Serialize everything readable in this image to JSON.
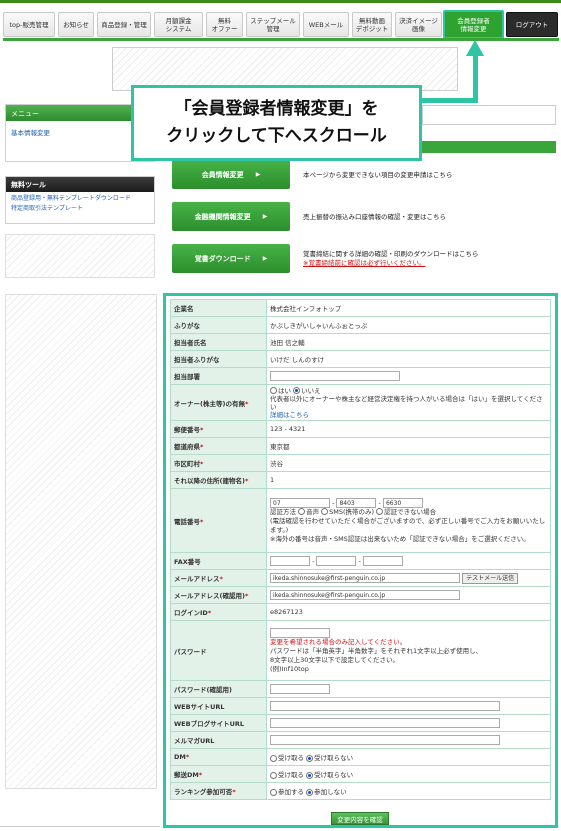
{
  "nav": {
    "items": [
      {
        "label": "top-販売管理"
      },
      {
        "label": "お知らせ"
      },
      {
        "label": "商品登録・管理"
      },
      {
        "label": "月額課金\nシステム"
      },
      {
        "label": "無料\nオファー"
      },
      {
        "label": "ステップメール\n管理"
      },
      {
        "label": "WEBメール"
      },
      {
        "label": "無料動画\nデポジット"
      },
      {
        "label": "決済イメージ\n画像"
      },
      {
        "label": "会員登録者\n情報変更"
      },
      {
        "label": "ログアウト"
      }
    ]
  },
  "sidebar": {
    "menu_title": "メニュー",
    "menu_item": "基本情報変更",
    "free_title": "無料ツール",
    "free_items": [
      "商品登録用・無料テンプレートダウンロード",
      "特定商取引法テンプレート"
    ]
  },
  "callout": {
    "line1": "「会員登録者情報変更」を",
    "line2": "クリックして下へスクロール"
  },
  "actions": [
    {
      "label": "会員情報変更",
      "arrow": "▶",
      "desc": [
        "本ページから変更できない項目の変更申請はこちら"
      ]
    },
    {
      "label": "金融機関情報変更",
      "arrow": "▶",
      "desc": [
        "売上振替の振込み口座情報の確認・変更はこちら"
      ]
    },
    {
      "label": "覚書ダウンロード",
      "arrow": "▶",
      "desc": [
        "覚書締結に関する詳細の確認・印刷のダウンロードはこちら"
      ],
      "desc_red": "※覚書締結前に確認は必ず行いください。"
    }
  ],
  "form": {
    "company_label": "企業名",
    "company": "株式会社インフォトップ",
    "company_kana_label": "ふりがな",
    "company_kana": "かぶしきがいしゃいんふぉとっぷ",
    "person_label": "担当者氏名",
    "person": "池田 信之輔",
    "person_kana_label": "担当者ふりがな",
    "person_kana": "いけだ しんのすけ",
    "dept_label": "担当部署",
    "owner_label": "オーナー(株主等)の有無",
    "owner_opt_yes": "はい",
    "owner_opt_no": "いいえ",
    "owner_note": "代表者以外にオーナーや株主など経営決定権を持つ人がいる場合は「はい」を選択してください",
    "owner_note_link": "詳細はこちら",
    "zip_label": "郵便番号",
    "zip": "123 - 4321",
    "pref_label": "都道府県",
    "pref": "東京都",
    "city_label": "市区町村",
    "city": "渋谷",
    "addr_label": "それ以降の住所(建物名)",
    "addr": "1",
    "tel_label": "電話番号",
    "tel1": "07",
    "tel2": "8403",
    "tel3": "6630",
    "tel_method_label": "認証方法",
    "tel_method_voice": "音声",
    "tel_method_sms": "SMS(携帯のみ)",
    "tel_method_none": "認証できない場合",
    "tel_note1": "(電話確認を行わせていただく場合がございますので、必ず正しい番号でご入力をお願いいたします。)",
    "tel_note2": "※海外の番号は音声・SMS認証は出来ないため「認証できない場合」をご選択ください。",
    "fax_label": "FAX番号",
    "email_label": "メールアドレス",
    "email": "ikeda.shinnosuke@first-penguin.co.jp",
    "test_mail": "テストメール送信",
    "email_confirm_label": "メールアドレス(確認用)",
    "email_confirm": "ikeda.shinnosuke@first-penguin.co.jp",
    "login_label": "ログインID",
    "login": "e8267123",
    "password_label": "パスワード",
    "pw_note_red": "変更を希望される場合のみ記入してください。",
    "pw_note1": "パスワードは「半角英字」半角数字」をそれぞれ1文字以上必ず使用し、",
    "pw_note2": "8文字以上30文字以下で設定してください。",
    "pw_note3": "(例)Inf10top",
    "pw_confirm_label": "パスワード(確認用)",
    "web_label": "WEBサイトURL",
    "blog_label": "WEBブログサイトURL",
    "mag_label": "メルマガURL",
    "dm_label": "DM",
    "dm_yes": "受け取る",
    "dm_no": "受け取らない",
    "post_dm_label": "郵送DM",
    "post_yes": "受け取る",
    "post_no": "受け取らない",
    "rank_label": "ランキング参加可否",
    "rank_yes": "参加する",
    "rank_no": "参加しない",
    "submit": "変更内容を確認"
  },
  "colors": {
    "brand_green": "#3aa53a",
    "highlight": "#2ec4a5",
    "required": "#d01010"
  }
}
